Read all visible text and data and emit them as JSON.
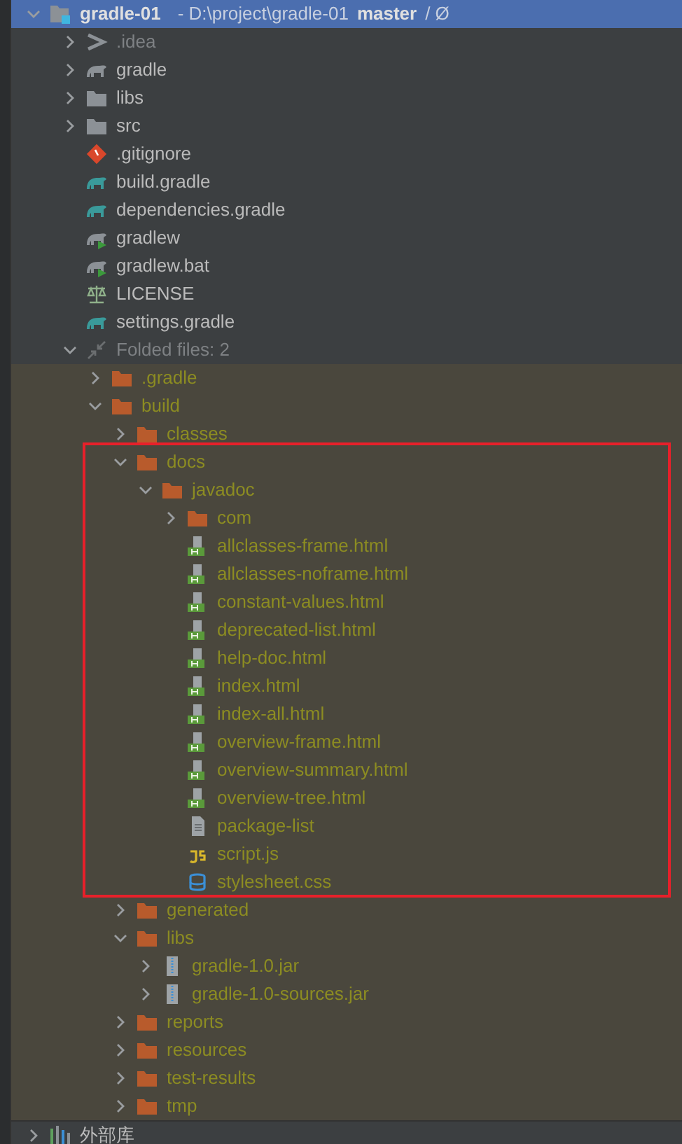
{
  "root": {
    "name": "gradle-01",
    "path": "- D:\\project\\gradle-01",
    "branch": "master",
    "suffix": "/ Ø",
    "expanded": true,
    "selected": true,
    "children": [
      {
        "name": ".idea",
        "kind": "idea",
        "expanded": false
      },
      {
        "name": "gradle",
        "kind": "gradle-folder",
        "expanded": false
      },
      {
        "name": "libs",
        "kind": "folder",
        "expanded": false
      },
      {
        "name": "src",
        "kind": "folder",
        "expanded": false
      },
      {
        "name": ".gitignore",
        "kind": "git"
      },
      {
        "name": "build.gradle",
        "kind": "gradle"
      },
      {
        "name": "dependencies.gradle",
        "kind": "gradle"
      },
      {
        "name": "gradlew",
        "kind": "gradlew"
      },
      {
        "name": "gradlew.bat",
        "kind": "gradlew"
      },
      {
        "name": "LICENSE",
        "kind": "license"
      },
      {
        "name": "settings.gradle",
        "kind": "gradle"
      },
      {
        "name": "Folded files: 2",
        "kind": "folded",
        "expanded": true,
        "excluded": true,
        "children": [
          {
            "name": ".gradle",
            "kind": "folder",
            "expanded": false
          },
          {
            "name": "build",
            "kind": "folder",
            "expanded": true,
            "children": [
              {
                "name": "classes",
                "kind": "folder",
                "expanded": false
              },
              {
                "name": "docs",
                "kind": "folder",
                "expanded": true,
                "highlighted": true,
                "children": [
                  {
                    "name": "javadoc",
                    "kind": "folder",
                    "expanded": true,
                    "children": [
                      {
                        "name": "com",
                        "kind": "folder",
                        "expanded": false
                      },
                      {
                        "name": "allclasses-frame.html",
                        "kind": "html"
                      },
                      {
                        "name": "allclasses-noframe.html",
                        "kind": "html"
                      },
                      {
                        "name": "constant-values.html",
                        "kind": "html"
                      },
                      {
                        "name": "deprecated-list.html",
                        "kind": "html"
                      },
                      {
                        "name": "help-doc.html",
                        "kind": "html"
                      },
                      {
                        "name": "index.html",
                        "kind": "html"
                      },
                      {
                        "name": "index-all.html",
                        "kind": "html"
                      },
                      {
                        "name": "overview-frame.html",
                        "kind": "html"
                      },
                      {
                        "name": "overview-summary.html",
                        "kind": "html"
                      },
                      {
                        "name": "overview-tree.html",
                        "kind": "html"
                      },
                      {
                        "name": "package-list",
                        "kind": "text"
                      },
                      {
                        "name": "script.js",
                        "kind": "js"
                      },
                      {
                        "name": "stylesheet.css",
                        "kind": "css"
                      }
                    ]
                  }
                ]
              },
              {
                "name": "generated",
                "kind": "folder",
                "expanded": false
              },
              {
                "name": "libs",
                "kind": "folder",
                "expanded": true,
                "children": [
                  {
                    "name": "gradle-1.0.jar",
                    "kind": "jar",
                    "expanded": false
                  },
                  {
                    "name": "gradle-1.0-sources.jar",
                    "kind": "jar",
                    "expanded": false
                  }
                ]
              },
              {
                "name": "reports",
                "kind": "folder",
                "expanded": false
              },
              {
                "name": "resources",
                "kind": "folder",
                "expanded": false
              },
              {
                "name": "test-results",
                "kind": "folder",
                "expanded": false
              },
              {
                "name": "tmp",
                "kind": "folder",
                "expanded": false
              }
            ]
          }
        ]
      }
    ]
  },
  "external": {
    "name": "外部库",
    "expanded": false
  }
}
